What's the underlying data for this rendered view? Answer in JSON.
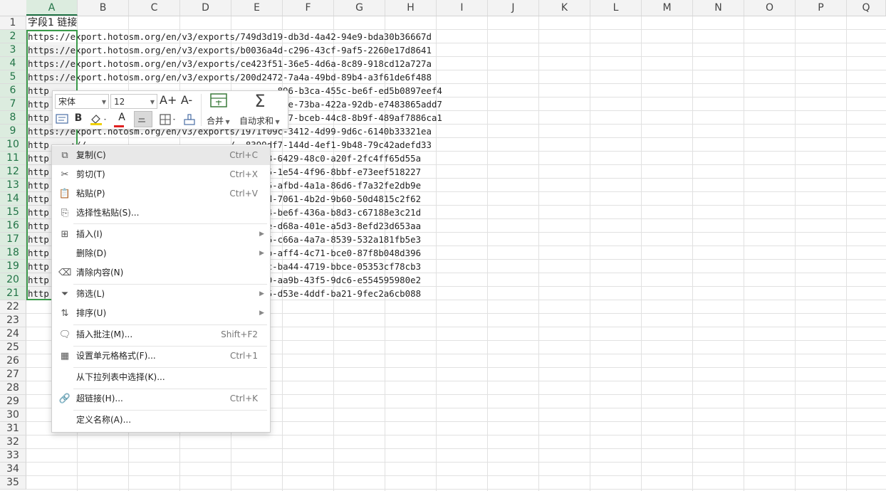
{
  "columns": [
    "A",
    "B",
    "C",
    "D",
    "E",
    "F",
    "G",
    "H",
    "I",
    "J",
    "K",
    "L",
    "M",
    "N",
    "O",
    "P",
    "Q"
  ],
  "rows": [
    "1",
    "2",
    "3",
    "4",
    "5",
    "6",
    "7",
    "8",
    "9",
    "10",
    "11",
    "12",
    "13",
    "14",
    "15",
    "16",
    "17",
    "18",
    "19",
    "20",
    "21",
    "22",
    "23",
    "24",
    "25",
    "26",
    "27",
    "28",
    "29",
    "30",
    "31",
    "32",
    "33",
    "34",
    "35"
  ],
  "cells": [
    "字段1 链接",
    "https://export.hotosm.org/en/v3/exports/749d3d19-db3d-4a42-94e9-bda30b36667d",
    "https://export.hotosm.org/en/v3/exports/b0036a4d-c296-43cf-9af5-2260e17d8641",
    "https://export.hotosm.org/en/v3/exports/ce423f51-36e5-4d6a-8c89-918cd12a727a",
    "https://export.hotosm.org/en/v3/exports/200d2472-7a4a-49bd-89b4-a3f61de6f488",
    "http                                           896-b3ca-455c-be6f-ed5b0897eef4",
    "http                                           ade-73ba-422a-92db-e7483865add7",
    "http                                           327-bceb-44c8-8b9f-489af7886ca1",
    "https://export.hotosm.org/en/v3/exports/1971f09c-3412-4d99-9d6c-6140b33321ea",
    "http    ://        .                  /  8399df7-144d-4ef1-9b48-79c42adefd33",
    "http                                    276148-6429-48c0-a20f-2fc4ff65d55a",
    "http                                    54e655-1e54-4f96-8bbf-e73eef518227",
    "http                                    8d55c5-afbd-4a1a-86d6-f7a32fe2db9e",
    "http                                    31785d-7061-4b2d-9b60-50d4815c2f62",
    "http                                    74d584-be6f-436a-b8d3-c67188e3c21d",
    "http                                    ad099e-d68a-401e-a5d3-8efd23d653aa",
    "http                                    27d346-c66a-4a7a-8539-532a181fb5e3",
    "http                                    ffc97b-aff4-4c71-bce0-87f8b048d396",
    "http                                    e1bfac-ba44-4719-bbce-05353cf78cb3",
    "http                                    c02f20-aa9b-43f5-9dc6-e554595980e2",
    "http                                    ed9065-d53e-4ddf-ba21-9fec2a6cb088"
  ],
  "mini_toolbar": {
    "font_name": "宋体",
    "font_size": "12",
    "increase_font": "A+",
    "decrease_font": "A-",
    "bold": "B",
    "font_color_glyph": "A",
    "merge_label": "合并",
    "autosum_label": "自动求和",
    "sigma": "Σ"
  },
  "context_menu": {
    "items": [
      {
        "label": "复制(C)",
        "shortcut": "Ctrl+C"
      },
      {
        "label": "剪切(T)",
        "shortcut": "Ctrl+X"
      },
      {
        "label": "粘贴(P)",
        "shortcut": "Ctrl+V"
      },
      {
        "label": "选择性粘贴(S)...",
        "shortcut": ""
      },
      {
        "label": "插入(I)",
        "shortcut": ""
      },
      {
        "label": "删除(D)",
        "shortcut": ""
      },
      {
        "label": "清除内容(N)",
        "shortcut": ""
      },
      {
        "label": "筛选(L)",
        "shortcut": ""
      },
      {
        "label": "排序(U)",
        "shortcut": ""
      },
      {
        "label": "插入批注(M)...",
        "shortcut": "Shift+F2"
      },
      {
        "label": "设置单元格格式(F)...",
        "shortcut": "Ctrl+1"
      },
      {
        "label": "从下拉列表中选择(K)...",
        "shortcut": ""
      },
      {
        "label": "超链接(H)...",
        "shortcut": "Ctrl+K"
      },
      {
        "label": "定义名称(A)...",
        "shortcut": ""
      }
    ]
  },
  "colors": {
    "selection": "#3a9a4a",
    "header_selected": "#217346"
  }
}
